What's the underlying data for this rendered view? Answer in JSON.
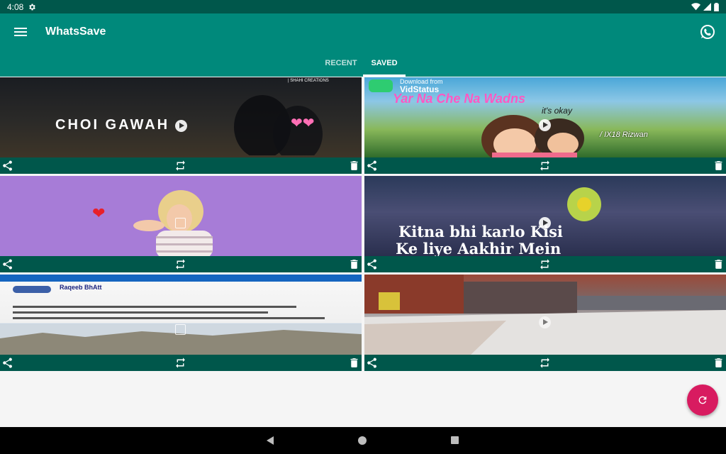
{
  "status": {
    "time": "4:08"
  },
  "app": {
    "title": "WhatsSave"
  },
  "tabs": [
    {
      "label": "RECENT",
      "selected": false
    },
    {
      "label": "SAVED",
      "selected": true
    }
  ],
  "items": [
    {
      "type": "video",
      "caption": "CHOI GAWAH",
      "corner_text": "| SHAHI CREATIONS"
    },
    {
      "type": "video",
      "brand_top": "Download from",
      "brand": "VidStatus",
      "headline": "Yar Na Che Na Wadns",
      "sub": "it's okay",
      "channel": "/ IX18 Rizwan"
    },
    {
      "type": "image"
    },
    {
      "type": "video",
      "line1": "Kitna bhi karlo Kisi",
      "line2": "Ke liye Aakhir Mein"
    },
    {
      "type": "image",
      "profile": "Raqeeb BhAtt"
    },
    {
      "type": "video"
    }
  ],
  "colors": {
    "primary": "#00897b",
    "primary_dark": "#00574b",
    "accent": "#d81b60"
  }
}
